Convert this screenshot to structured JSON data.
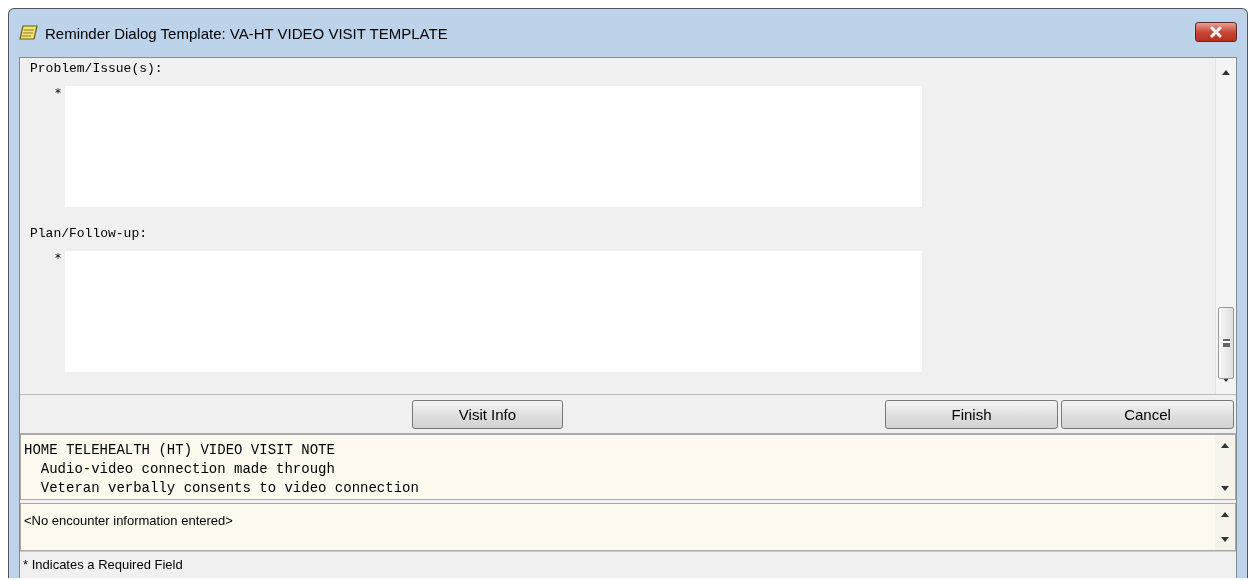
{
  "window": {
    "title": "Reminder Dialog Template: VA-HT VIDEO VISIT TEMPLATE"
  },
  "sections": [
    {
      "label": "Problem/Issue(s):",
      "required_mark": "*"
    },
    {
      "label": "Plan/Follow-up:",
      "required_mark": "*"
    }
  ],
  "buttons": [
    {
      "label": "Visit Info"
    },
    {
      "label": "Finish"
    },
    {
      "label": "Cancel"
    }
  ],
  "note_text": [
    "HOME TELEHEALTH (HT) VIDEO VISIT NOTE",
    "  Audio-video connection made through",
    "  Veteran verbally consents to video connection"
  ],
  "encounter_text": "<No encounter information entered>",
  "status_bar": "* Indicates a Required Field"
}
